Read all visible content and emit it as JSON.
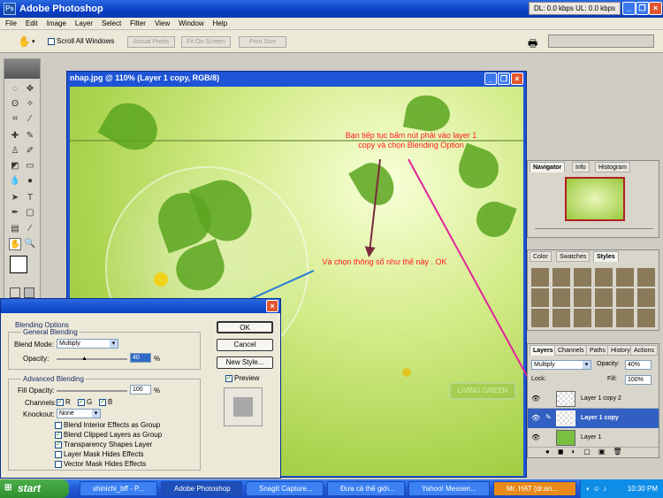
{
  "app": {
    "title": "Adobe Photoshop",
    "net_status": "DL: 0.0 kbps  UL: 0.0 kbps"
  },
  "menu": [
    "File",
    "Edit",
    "Image",
    "Layer",
    "Select",
    "Filter",
    "View",
    "Window",
    "Help"
  ],
  "options": {
    "scroll_all": "Scroll All Windows",
    "actual_pixels": "Actual Pixels",
    "fit_on_screen": "Fit On Screen",
    "print_size": "Print Size"
  },
  "document": {
    "title": "nhap.jpg @ 110% (Layer 1 copy, RGB/8)",
    "annotation_top": "Bạn tiếp tục bấm nút phải vào layer 1 copy và chọn Blending Option",
    "annotation_mid": "Và chọn thông số như thế này . OK",
    "watermark": "LIVING GREEN"
  },
  "navigator": {
    "tabs": [
      "Navigator",
      "Info",
      "Histogram"
    ]
  },
  "styles": {
    "tabs": [
      "Color",
      "Swatches",
      "Styles"
    ]
  },
  "layers": {
    "tabs": [
      "Layers",
      "Channels",
      "Paths",
      "History",
      "Actions"
    ],
    "blend": "Multiply",
    "opacity_label": "Opacity:",
    "opacity": "40%",
    "lock_label": "Lock:",
    "fill_label": "Fill:",
    "fill": "100%",
    "items": [
      {
        "name": "Layer 1 copy 2",
        "selected": false
      },
      {
        "name": "Layer 1 copy",
        "selected": true
      },
      {
        "name": "Layer 1",
        "selected": false
      }
    ]
  },
  "dialog": {
    "sidebar": "Blending Options",
    "general": "General Blending",
    "blend_mode_label": "Blend Mode:",
    "blend_mode": "Multiply",
    "opacity_label": "Opacity:",
    "opacity": "40",
    "pct": "%",
    "advanced": "Advanced Blending",
    "fill_label": "Fill Opacity:",
    "fill": "100",
    "channels_label": "Channels:",
    "ch_r": "R",
    "ch_g": "G",
    "ch_b": "B",
    "knockout_label": "Knockout:",
    "knockout": "None",
    "opts": [
      {
        "label": "Blend Interior Effects as Group",
        "checked": false
      },
      {
        "label": "Blend Clipped Layers as Group",
        "checked": true
      },
      {
        "label": "Transparency Shapes Layer",
        "checked": true
      },
      {
        "label": "Layer Mask Hides Effects",
        "checked": false
      },
      {
        "label": "Vector Mask Hides Effects",
        "checked": false
      }
    ],
    "ok": "OK",
    "cancel": "Cancel",
    "new_style": "New Style...",
    "preview": "Preview"
  },
  "taskbar": {
    "start": "start",
    "tasks": [
      {
        "label": "shinichi_bff - P...",
        "on": false
      },
      {
        "label": "Adobe Photoshop",
        "on": true
      },
      {
        "label": "SnagIt Capture...",
        "on": false
      },
      {
        "label": "Đưa cả thế giới...",
        "on": false
      },
      {
        "label": "Yahoo! Messen...",
        "on": false
      },
      {
        "label": "Mr. HAT (dr.an...",
        "on": false
      }
    ],
    "clock": "10:30 PM"
  }
}
